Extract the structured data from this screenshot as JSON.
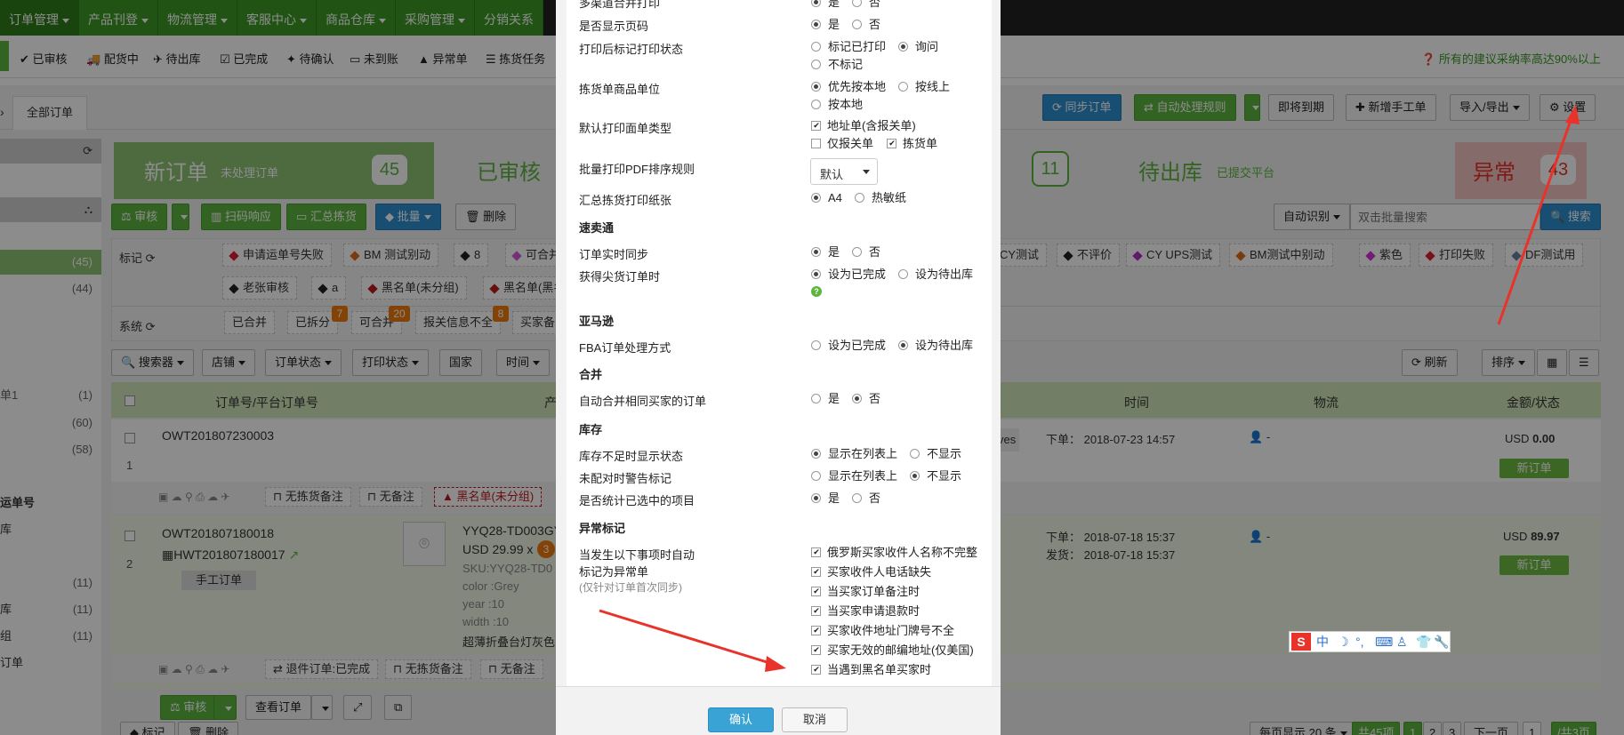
{
  "topnav": {
    "items": [
      "订单管理",
      "产品刊登",
      "物流管理",
      "客服中心",
      "商品仓库",
      "采购管理",
      "分销关系"
    ]
  },
  "subbar": {
    "items": [
      "已审核",
      "配货中",
      "待出库",
      "已完成",
      "待确认",
      "未到账",
      "异常单",
      "拣货任务"
    ],
    "tip": "所有的建议采纳率高达90%以上"
  },
  "tabs": {
    "all_orders": "全部订单"
  },
  "toolbar_right": {
    "sync": "同步订单",
    "auto_rule": "自动处理规则",
    "expiring": "即将到期",
    "new_manual": "新增手工单",
    "import_export": "导入/导出",
    "settings": "设置"
  },
  "status_cards": {
    "new_title": "新订单",
    "new_sub": "未处理订单",
    "new_count": "45",
    "audited_title": "已审核",
    "mid_count": "11",
    "pending_title": "待出库",
    "pending_sub": "已提交平台",
    "abnormal_title": "异常",
    "abnormal_count": "43"
  },
  "sidebar": {
    "counts": [
      "(45)",
      "(44)",
      "(1)",
      "(60)",
      "(58)",
      "(11)",
      "(11)",
      "(11)"
    ],
    "labels": [
      "单1",
      "运单号",
      "库",
      "库",
      "组",
      "订单"
    ]
  },
  "actions": {
    "audit": "审核",
    "scan": "扫码响应",
    "summary": "汇总拣货",
    "batch": "批量",
    "delete": "删除",
    "auto_detect": "自动识别",
    "search_placeholder": "双击批量搜索",
    "search": "搜索"
  },
  "tags": {
    "label_title": "标记",
    "system_title": "系统",
    "row1": [
      "申请运单号失败",
      "BM 测试别动",
      "8",
      "可合并",
      "CY测试",
      "不评价",
      "CY UPS测试",
      "BM测试中别动",
      "紫色",
      "打印失败",
      "DF测试用"
    ],
    "row2": [
      "老张审核",
      "a",
      "黑名单(未分组)",
      "黑名单(黑名"
    ],
    "system": [
      "已合并",
      "已拆分",
      "可合并",
      "报关信息不全",
      "买家备"
    ],
    "system_badges": [
      "7",
      "20",
      "8"
    ]
  },
  "filters": [
    "搜索器",
    "店铺",
    "订单状态",
    "打印状态",
    "国家",
    "时间"
  ],
  "filters_right": {
    "refresh": "刷新",
    "sort": "排序"
  },
  "table": {
    "headers": [
      "订单号/平台订单号",
      "产",
      "时间",
      "物流",
      "金额/状态"
    ],
    "row1": {
      "order_no": "OWT201807230003",
      "index": "1",
      "time": "下单： 2018-07-23 14:57",
      "logistics": "-",
      "amount": "USD",
      "amount_value": "0.00",
      "status": "新订单",
      "notes": [
        "无拣货备注",
        "无备注",
        "黑名单(未分组)"
      ],
      "partial": "ves"
    },
    "row2": {
      "order_no": "OWT201807180018",
      "platform_no": "HWT201807180017",
      "index": "2",
      "manual": "手工订单",
      "sku_title": "YYQ28-TD003GY",
      "price": "USD 29.99 x",
      "qty": "3",
      "sku": "SKU:YYQ28-TD0",
      "attrs": [
        "color :Grey",
        "year :10",
        "width :10"
      ],
      "desc": "超薄折叠台灯灰色",
      "time_order": "下单： 2018-07-18 15:37",
      "time_ship": "发货： 2018-07-18 15:37",
      "logistics": "-",
      "amount": "USD",
      "amount_value": "89.97",
      "status": "新订单",
      "notes": [
        "退件订单:已完成",
        "无拣货备注",
        "无备注"
      ],
      "audit": "审核",
      "view": "查看订单"
    }
  },
  "bottom": {
    "mark": "标记",
    "delete": "删除",
    "per_page": "每页显示 20 条",
    "total": "共45项",
    "pages": [
      "1",
      "2",
      "3"
    ],
    "next": "下一页",
    "page_input": "1",
    "total_pages": "/共3页"
  },
  "modal": {
    "rows": [
      {
        "label": "多渠道合并打印",
        "opts": [
          "是",
          "否"
        ],
        "sel": 0
      },
      {
        "label": "是否显示页码",
        "opts": [
          "是",
          "否"
        ],
        "sel": 0
      },
      {
        "label": "打印后标记打印状态",
        "opts": [
          "标记已打印",
          "询问",
          "不标记"
        ],
        "sel": 1
      },
      {
        "label": "拣货单商品单位",
        "opts": [
          "优先按本地",
          "按线上",
          "按本地"
        ],
        "sel": 0
      },
      {
        "label": "默认打印面单类型",
        "opts": [
          "地址单(含报关单)",
          "仅报关单",
          "拣货单"
        ],
        "checked": [
          true,
          false,
          true
        ]
      },
      {
        "label": "批量打印PDF排序规则",
        "select": "默认"
      },
      {
        "label": "汇总拣货打印纸张",
        "opts": [
          "A4",
          "热敏纸"
        ],
        "sel": 0
      }
    ],
    "sec_sumaitong": "速卖通",
    "sync_label": "订单实时同步",
    "sync_opts": [
      "是",
      "否"
    ],
    "fetch_label": "获得尖货订单时",
    "fetch_opts": [
      "设为已完成",
      "设为待出库"
    ],
    "sec_amazon": "亚马逊",
    "fba_label": "FBA订单处理方式",
    "fba_opts": [
      "设为已完成",
      "设为待出库"
    ],
    "sec_merge": "合并",
    "merge_label": "自动合并相同买家的订单",
    "merge_opts": [
      "是",
      "否"
    ],
    "sec_stock": "库存",
    "stock_rows": [
      {
        "label": "库存不足时显示状态",
        "opts": [
          "显示在列表上",
          "不显示"
        ],
        "sel": 0
      },
      {
        "label": "未配对时警告标记",
        "opts": [
          "显示在列表上",
          "不显示"
        ],
        "sel": 1
      },
      {
        "label": "是否统计已选中的项目",
        "opts": [
          "是",
          "否"
        ],
        "sel": 0
      }
    ],
    "sec_abnormal": "异常标记",
    "abnormal_label1": "当发生以下事项时自动",
    "abnormal_label2": "标记为异常单",
    "abnormal_note": "(仅针对订单首次同步)",
    "abnormal_opts": [
      "俄罗斯买家收件人名称不完整",
      "买家收件人电话缺失",
      "当买家订单备注时",
      "当买家申请退款时",
      "买家收件地址门牌号不全",
      "买家无效的邮编地址(仅美国)",
      "当遇到黑名单买家时"
    ],
    "confirm": "确认",
    "cancel": "取消"
  },
  "ime": {
    "lang": "中"
  },
  "colors": {
    "green": "#5db53f",
    "blue": "#2f8fd1",
    "orange": "#f07a0b",
    "red": "#e8322a"
  }
}
